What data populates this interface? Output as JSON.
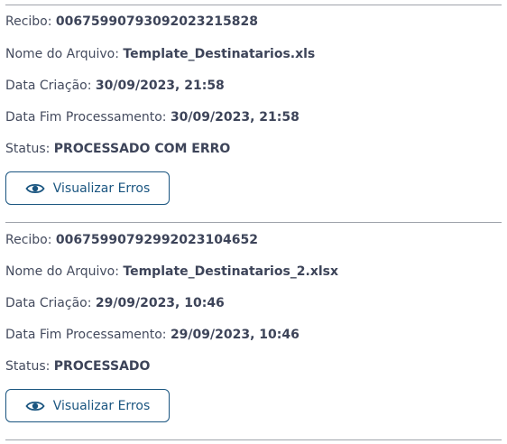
{
  "records": [
    {
      "receipt_label": "Recibo:",
      "receipt_value": "0067599079309202321 5828",
      "filename_label": "Nome do Arquivo:",
      "filename_value": "Template_Destinatarios.xls",
      "created_label": "Data Criação:",
      "created_value": "30/09/2023, 21:58",
      "end_label": "Data Fim Processamento:",
      "end_value": "30/09/2023, 21:58",
      "status_label": "Status:",
      "status_value": "PROCESSADO COM ERRO",
      "button_label": "Visualizar Erros",
      "button_icon": "eye-icon"
    },
    {
      "receipt_label": "Recibo:",
      "receipt_value": "0067599079299202310 4652",
      "filename_label": "Nome do Arquivo:",
      "filename_value": "Template_Destinatarios_2.xlsx",
      "created_label": "Data Criação:",
      "created_value": "29/09/2023, 10:46",
      "end_label": "Data Fim Processamento:",
      "end_value": "29/09/2023, 10:46",
      "status_label": "Status:",
      "status_value": "PROCESSADO",
      "button_label": "Visualizar Erros",
      "button_icon": "eye-icon"
    }
  ],
  "colors": {
    "text": "#444b5e",
    "accent": "#1a5580",
    "divider": "#9fa3ab"
  }
}
